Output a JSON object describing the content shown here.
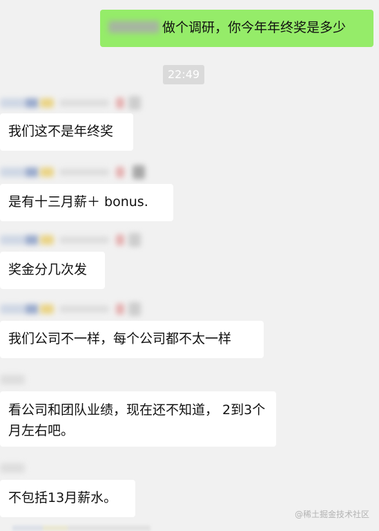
{
  "conversation": {
    "sent": {
      "text": "做个调研，你今年年终奖是多少"
    },
    "timestamp": "22:49",
    "received": [
      {
        "text": "我们这不是年终奖"
      },
      {
        "text": "是有十三月薪＋ bonus."
      },
      {
        "text": "奖金分几次发"
      },
      {
        "text": "我们公司不一样，每个公司都不太一样"
      },
      {
        "text": "看公司和团队业绩，现在还不知道， 2到3个月左右吧。"
      },
      {
        "text": "不包括13月薪水。"
      }
    ]
  },
  "watermark": "@稀土掘金技术社区",
  "colors": {
    "background": "#f1f1f1",
    "sent_bubble": "#95ec69",
    "received_bubble": "#ffffff",
    "time_pill": "#dadada"
  }
}
